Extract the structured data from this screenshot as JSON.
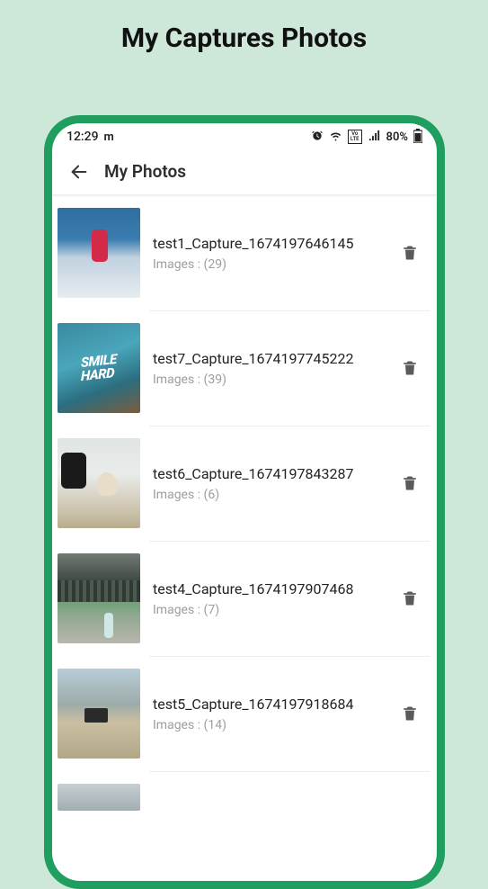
{
  "page": {
    "title": "My Captures Photos"
  },
  "statusbar": {
    "time": "12:29",
    "carrier_logo": "m",
    "volte_label": "Vo\nLTE",
    "battery_pct": "80%"
  },
  "appbar": {
    "title": "My Photos"
  },
  "images_label_prefix": "Images : ",
  "items": [
    {
      "title": "test1_Capture_1674197646145",
      "count": "(29)"
    },
    {
      "title": "test7_Capture_1674197745222",
      "count": "(39)"
    },
    {
      "title": "test6_Capture_1674197843287",
      "count": "(6)"
    },
    {
      "title": "test4_Capture_1674197907468",
      "count": "(7)"
    },
    {
      "title": "test5_Capture_1674197918684",
      "count": "(14)"
    }
  ]
}
